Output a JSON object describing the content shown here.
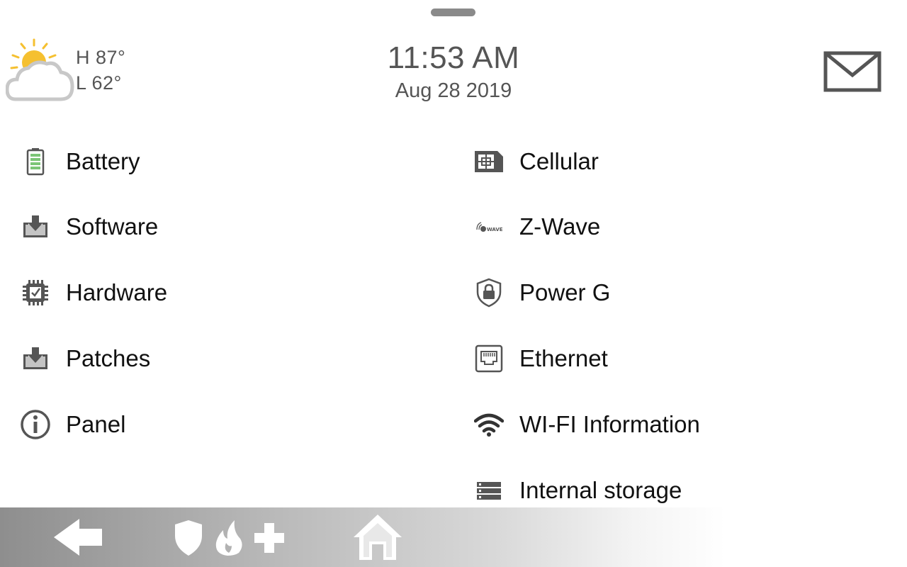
{
  "header": {
    "weather": {
      "icon": "partly-sunny-icon",
      "high": "H 87°",
      "low": "L 62°"
    },
    "time": "11:53 AM",
    "date": "Aug 28 2019",
    "messages_icon": "mail-icon"
  },
  "menu": {
    "left": [
      {
        "label": "Battery",
        "icon": "battery-icon"
      },
      {
        "label": "Software",
        "icon": "download-tray-icon"
      },
      {
        "label": "Hardware",
        "icon": "chip-check-icon"
      },
      {
        "label": "Patches",
        "icon": "download-tray-icon"
      },
      {
        "label": "Panel",
        "icon": "info-icon"
      }
    ],
    "right": [
      {
        "label": "Cellular",
        "icon": "sim-card-icon"
      },
      {
        "label": "Z-Wave",
        "icon": "zwave-icon"
      },
      {
        "label": "Power G",
        "icon": "shield-lock-icon"
      },
      {
        "label": "Ethernet",
        "icon": "ethernet-port-icon"
      },
      {
        "label": "WI-FI Information",
        "icon": "wifi-icon"
      },
      {
        "label": "Internal storage",
        "icon": "storage-icon"
      }
    ]
  },
  "zwave_badge": "WAVE",
  "bottom_nav": [
    {
      "name": "back",
      "icon": "back-arrow-icon"
    },
    {
      "name": "emergency",
      "icon": "shield-fire-medical-icon"
    },
    {
      "name": "home",
      "icon": "home-icon"
    }
  ],
  "colors": {
    "icon_gray": "#555555",
    "battery_green": "#7cc576",
    "sun_yellow": "#f5c030"
  }
}
